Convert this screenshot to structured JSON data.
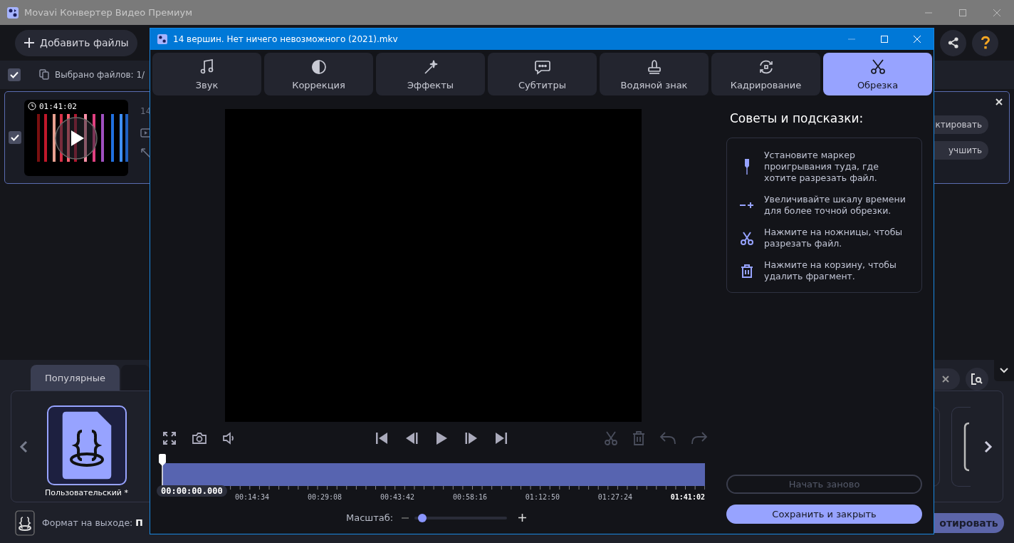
{
  "app_window": {
    "title": "Movavi Конвертер Видео Премиум"
  },
  "toolbar": {
    "add_files": "Добавить файлы"
  },
  "selection_bar": {
    "checked": true,
    "label": "Выбрано файлов: 1/"
  },
  "file_item": {
    "checked": true,
    "duration": "01:41:02",
    "name": "14",
    "buttons": [
      "ктировать",
      "учшить"
    ]
  },
  "format_panel": {
    "tabs": [
      {
        "label": "Популярные",
        "selected": true
      }
    ],
    "tiles": [
      {
        "label": "Пользовательский *",
        "selected": true
      }
    ]
  },
  "output_bar": {
    "label": "Формат на выходе: **П**",
    "convert_button": "отировать"
  },
  "editor_window": {
    "title": "14 вершин. Нет ничего невозможного (2021).mkv",
    "tabs": [
      {
        "kind": "sound",
        "label": "Звук",
        "selected": false
      },
      {
        "kind": "correction",
        "label": "Коррекция",
        "selected": false
      },
      {
        "kind": "effects",
        "label": "Эффекты",
        "selected": false
      },
      {
        "kind": "subtitles",
        "label": "Субтитры",
        "selected": false
      },
      {
        "kind": "watermark",
        "label": "Водяной знак",
        "selected": false
      },
      {
        "kind": "crop",
        "label": "Кадрирование",
        "selected": false
      },
      {
        "kind": "trim",
        "label": "Обрезка",
        "selected": true
      }
    ],
    "timeline": {
      "playhead": {
        "time": "00:00:00.000",
        "level": 0
      },
      "ticks": [
        "00:14:34",
        "00:29:08",
        "00:43:42",
        "00:58:16",
        "01:12:50",
        "01:27:24",
        "01:41:02"
      ]
    },
    "zoom": {
      "label": "Масштаб:",
      "level": 0.08
    },
    "tips": {
      "title": "Советы и подсказки:",
      "items": [
        {
          "kind": "marker",
          "text": "Установите маркер проигрывания туда, где хотите разрезать файл."
        },
        {
          "kind": "zoom",
          "text": "Увеличивайте шкалу времени для более точной обрезки."
        },
        {
          "kind": "scissors",
          "text": "Нажмите на ножницы, чтобы разрезать файл."
        },
        {
          "kind": "trash",
          "text": "Нажмите на корзину, чтобы удалить фрагмент."
        }
      ]
    },
    "buttons": [
      {
        "label": "Начать заново",
        "disabled": true
      },
      {
        "label": "Сохранить и закрыть",
        "disabled": false
      }
    ]
  }
}
